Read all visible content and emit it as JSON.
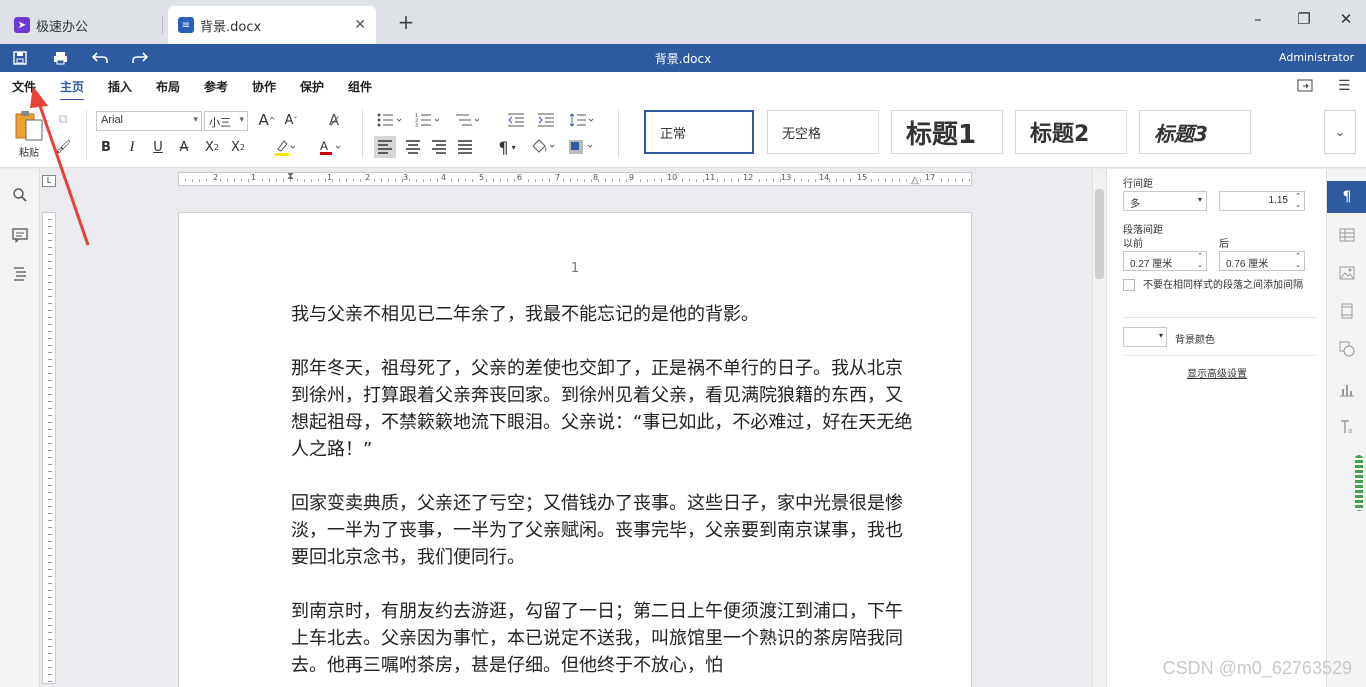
{
  "tabs": {
    "app_title": "极速办公",
    "doc_title": "背景.docx",
    "close_glyph": "✕",
    "new_glyph": "+"
  },
  "window": {
    "minimize": "–",
    "restore": "❐",
    "close": "✕"
  },
  "titlebar": {
    "doc_title": "背景.docx",
    "user": "Administrator"
  },
  "menus": [
    "文件",
    "主页",
    "插入",
    "布局",
    "参考",
    "协作",
    "保护",
    "组件"
  ],
  "active_menu": "主页",
  "ribbon": {
    "paste_label": "粘贴",
    "font_name": "Arial",
    "font_size": "小三",
    "styles": [
      "正常",
      "无空格",
      "标题1",
      "标题2",
      "标题3"
    ]
  },
  "ruler": {
    "numbers": [
      "2",
      "1",
      "1",
      "2",
      "3",
      "4",
      "5",
      "6",
      "7",
      "8",
      "9",
      "10",
      "11",
      "12",
      "13",
      "14",
      "15",
      "16",
      "17"
    ]
  },
  "document": {
    "page_number": "1",
    "paragraphs": [
      "我与父亲不相见已二年余了，我最不能忘记的是他的背影。",
      "那年冬天，祖母死了，父亲的差使也交卸了，正是祸不单行的日子。我从北京到徐州，打算跟着父亲奔丧回家。到徐州见着父亲，看见满院狼籍的东西，又想起祖母，不禁簌簌地流下眼泪。父亲说：“事已如此，不必难过，好在天无绝人之路！”",
      "回家变卖典质，父亲还了亏空；又借钱办了丧事。这些日子，家中光景很是惨淡，一半为了丧事，一半为了父亲赋闲。丧事完毕，父亲要到南京谋事，我也要回北京念书，我们便同行。",
      "到南京时，有朋友约去游逛，勾留了一日；第二日上午便须渡江到浦口，下午上车北去。父亲因为事忙，本已说定不送我，叫旅馆里一个熟识的茶房陪我同去。他再三嘱咐茶房，甚是仔细。但他终于不放心，怕"
    ]
  },
  "panel": {
    "line_spacing_label": "行间距",
    "line_spacing_mode": "多",
    "line_spacing_value": "1.15",
    "para_spacing_label": "段落间距",
    "before_label": "以前",
    "after_label": "后",
    "before_value": "0.27 厘米",
    "after_value": "0.76 厘米",
    "no_space_same_style": "不要在相同样式的段落之间添加间隔",
    "bg_color_label": "背景颜色",
    "advanced_link": "显示高级设置"
  },
  "watermark": "CSDN @m0_62763529",
  "colors": {
    "brand": "#2d5aa0",
    "annotation_arrow": "#e8413a"
  }
}
